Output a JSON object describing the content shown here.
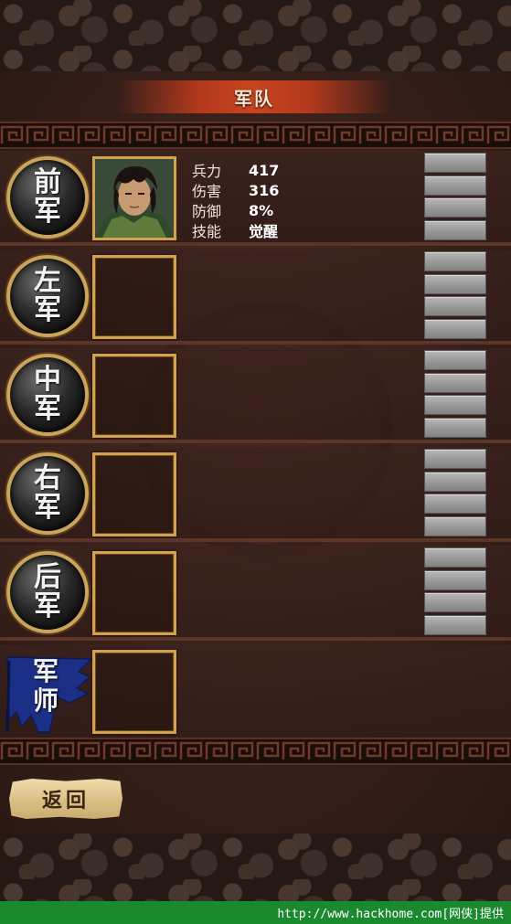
{
  "header": {
    "title": "军队"
  },
  "rows": [
    {
      "position": [
        "前",
        "军"
      ],
      "filled": true,
      "stats": [
        {
          "label": "兵力",
          "value": "417"
        },
        {
          "label": "伤害",
          "value": "316"
        },
        {
          "label": "防御",
          "value": "8%"
        },
        {
          "label": "技能",
          "value": "觉醒"
        }
      ]
    },
    {
      "position": [
        "左",
        "军"
      ],
      "filled": false
    },
    {
      "position": [
        "中",
        "军"
      ],
      "filled": false
    },
    {
      "position": [
        "右",
        "军"
      ],
      "filled": false
    },
    {
      "position": [
        "后",
        "军"
      ],
      "filled": false
    },
    {
      "position": [
        "军",
        "师"
      ],
      "filled": false,
      "flag": true
    }
  ],
  "footer": {
    "back_label": "返回"
  },
  "watermark": "http://www.hackhome.com[网侠]提供",
  "colors": {
    "accent_red": "#c8441f",
    "gold_border": "#d3a24a",
    "flag_blue": "#1c2f86",
    "watermark_green": "#1b8a2e"
  },
  "icons": {
    "meander": "greek-key-pattern",
    "flag": "blue-banner-icon",
    "emblem": "dragon-emblem"
  }
}
